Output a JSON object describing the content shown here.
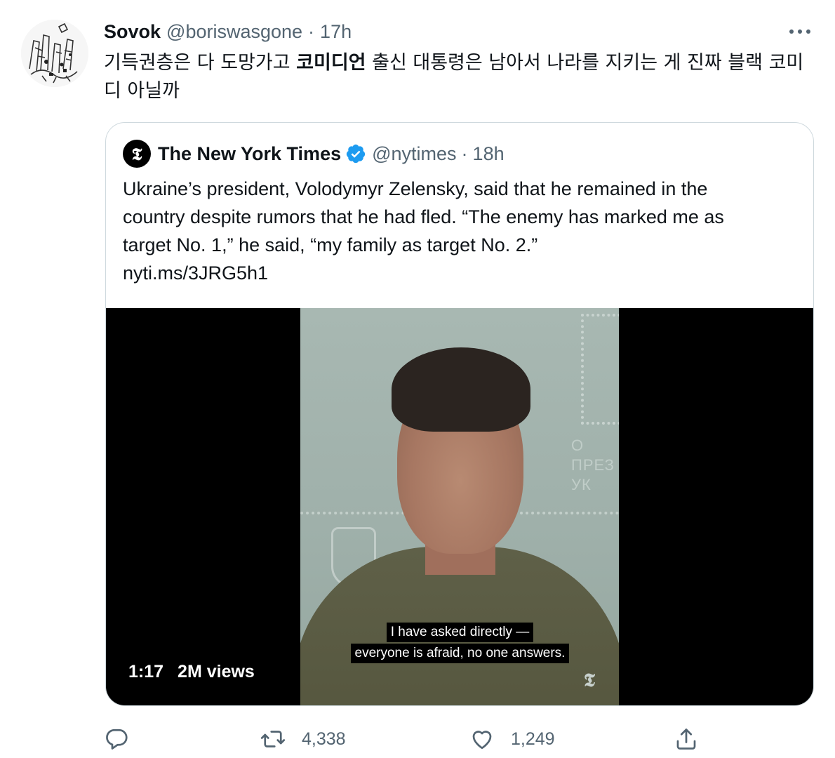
{
  "tweet": {
    "author_name": "Sovok",
    "author_handle": "@boriswasgone",
    "separator": "·",
    "time": "17h",
    "text_before_bold": "기득권층은 다 도망가고 ",
    "text_bold": "코미디언",
    "text_after_bold": " 출신 대통령은 남아서 나라를 지키는 게 진짜 블랙 코미디 아닐까"
  },
  "quoted_tweet": {
    "logo_glyph": "𝕿",
    "author_name": "The New York Times",
    "author_handle": "@nytimes",
    "separator": "·",
    "time": "18h",
    "text_lines": [
      "Ukraine’s president, Volodymyr Zelensky, said that he remained in the",
      "country despite rumors that he had fled. “The enemy has marked me as",
      "target No. 1,” he said, “my family as target No. 2.”",
      "nyti.ms/3JRG5h1"
    ],
    "video": {
      "duration": "1:17",
      "views": "2M views",
      "subtitle_line_1": "I have asked directly —",
      "subtitle_line_2": "everyone is afraid, no one answers.",
      "background_text": "О\nПРЕЗ\nУК",
      "watermark": "𝕿"
    }
  },
  "actions": {
    "reply_count": "",
    "retweet_count": "4,338",
    "like_count": "1,249"
  },
  "colors": {
    "text_primary": "#0f1419",
    "text_secondary": "#536471",
    "border": "#cfd9de",
    "verified_blue": "#1d9bf0"
  },
  "icons": [
    "more-icon",
    "verified-badge-icon",
    "reply-icon",
    "retweet-icon",
    "like-icon",
    "share-icon"
  ]
}
